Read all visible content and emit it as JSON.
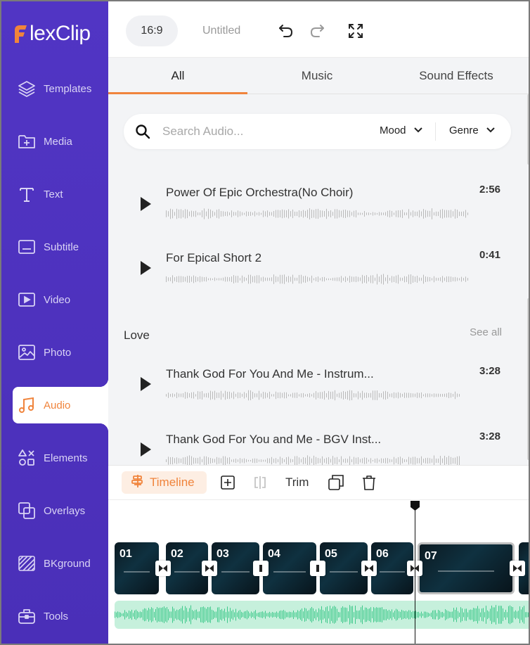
{
  "brand": {
    "name": "lexClip",
    "accent": "#f0843c",
    "sidebar_color": "#5135c4"
  },
  "sidebar": {
    "items": [
      {
        "label": "Templates",
        "icon": "layers-icon"
      },
      {
        "label": "Media",
        "icon": "folder-plus-icon"
      },
      {
        "label": "Text",
        "icon": "text-icon"
      },
      {
        "label": "Subtitle",
        "icon": "subtitle-icon"
      },
      {
        "label": "Video",
        "icon": "video-icon"
      },
      {
        "label": "Photo",
        "icon": "photo-icon"
      },
      {
        "label": "Audio",
        "icon": "music-icon",
        "active": true
      },
      {
        "label": "Elements",
        "icon": "shapes-icon"
      },
      {
        "label": "Overlays",
        "icon": "overlays-icon"
      },
      {
        "label": "BKground",
        "icon": "background-icon"
      },
      {
        "label": "Tools",
        "icon": "toolbox-icon"
      }
    ]
  },
  "topbar": {
    "aspect_ratio": "16:9",
    "title": "Untitled",
    "icons": [
      "undo-icon",
      "redo-icon",
      "fullscreen-icon"
    ]
  },
  "tabs": [
    {
      "label": "All",
      "active": true
    },
    {
      "label": "Music"
    },
    {
      "label": "Sound Effects"
    }
  ],
  "search": {
    "placeholder": "Search Audio...",
    "filters": [
      "Mood",
      "Genre"
    ]
  },
  "tracks_top": [
    {
      "title": "Power Of Epic Orchestra(No Choir)",
      "duration": "2:56"
    },
    {
      "title": "For Epical Short 2",
      "duration": "0:41"
    }
  ],
  "section": {
    "title": "Love",
    "see_all": "See all"
  },
  "tracks_love": [
    {
      "title": "Thank God For You And Me - Instrum...",
      "duration": "3:28"
    },
    {
      "title": "Thank God For You and Me - BGV Inst...",
      "duration": "3:28"
    }
  ],
  "timeline_toolbar": {
    "timeline_label": "Timeline",
    "trim_label": "Trim",
    "icons": [
      "add-icon",
      "split-icon",
      "duplicate-icon",
      "delete-icon"
    ]
  },
  "clips": [
    "01",
    "02",
    "03",
    "04",
    "05",
    "06",
    "07"
  ],
  "selected_clip": "07"
}
